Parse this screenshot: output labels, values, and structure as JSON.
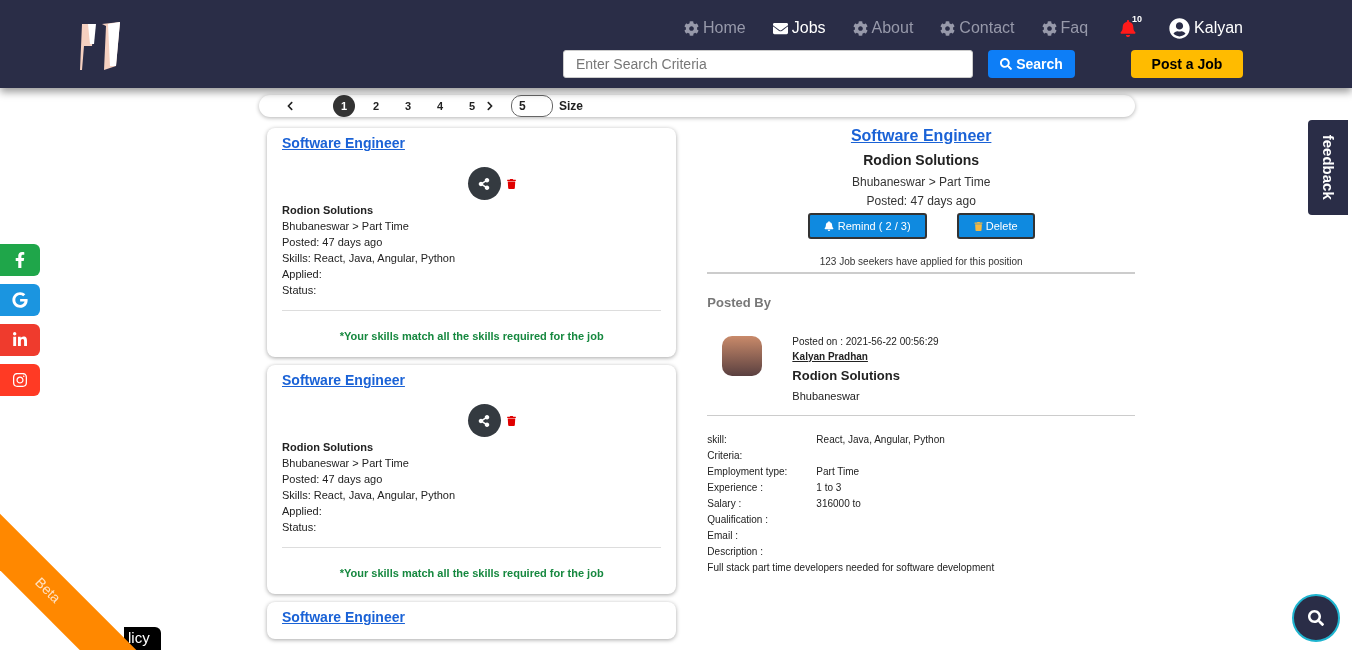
{
  "nav": {
    "items": [
      {
        "label": "Home",
        "kind": "settings",
        "selected": false
      },
      {
        "label": "Jobs",
        "kind": "mail",
        "selected": true
      },
      {
        "label": "About",
        "kind": "settings",
        "selected": false
      },
      {
        "label": "Contact",
        "kind": "settings",
        "selected": false
      },
      {
        "label": "Faq",
        "kind": "settings",
        "selected": false
      }
    ],
    "notification_count": "10",
    "user": "Kalyan"
  },
  "search": {
    "placeholder": "Enter Search Criteria",
    "button": "Search"
  },
  "post_job_button": "Post a Job",
  "pagination": {
    "pages": [
      {
        "label": "1",
        "selected": true
      },
      {
        "label": "2",
        "selected": false
      },
      {
        "label": "3",
        "selected": false
      },
      {
        "label": "4",
        "selected": false
      },
      {
        "label": "5",
        "selected": false
      }
    ],
    "size_value": "5",
    "size_label": "Size"
  },
  "job_cards": [
    {
      "title": "Software Engineer",
      "company": "Rodion Solutions",
      "location": "Bhubaneswar > Part Time",
      "posted": "Posted: 47 days ago",
      "skills": "Skills: React, Java, Angular, Python",
      "applied": "Applied:",
      "status": "Status:",
      "match": "*Your skills match all the skills required for the job"
    },
    {
      "title": "Software Engineer",
      "company": "Rodion Solutions",
      "location": "Bhubaneswar > Part Time",
      "posted": "Posted: 47 days ago",
      "skills": "Skills: React, Java, Angular, Python",
      "applied": "Applied:",
      "status": "Status:",
      "match": "*Your skills match all the skills required for the job"
    },
    {
      "title": "Software Engineer"
    }
  ],
  "detail": {
    "title": "Software Engineer",
    "company": "Rodion Solutions",
    "location": "Bhubaneswar > Part Time",
    "posted": "Posted: 47 days ago",
    "remind_button": "Remind ( 2 / 3)",
    "delete_button": "Delete",
    "applicants": "123 Job seekers have applied for this position",
    "posted_by_heading": "Posted By",
    "poster": {
      "posted_on": "Posted on : 2021-56-22 00:56:29",
      "name": "Kalyan Pradhan",
      "company": "Rodion Solutions",
      "city": "Bhubaneswar"
    },
    "fields": [
      {
        "label": "skill:",
        "value": "React, Java, Angular, Python"
      },
      {
        "label": "Criteria:"
      },
      {
        "label": "Employment type:",
        "value": "Part Time"
      },
      {
        "label": "Experience :",
        "value": "1 to 3"
      },
      {
        "label": "Salary :",
        "value": "316000 to"
      },
      {
        "label": "Qualification :"
      },
      {
        "label": "Email :"
      },
      {
        "label": "Description :"
      }
    ],
    "description": "Full stack part time developers needed for software development"
  },
  "social": [
    {
      "kind": "facebook",
      "color": "#1fa64a"
    },
    {
      "kind": "google",
      "color": "#1b95e0"
    },
    {
      "kind": "linkedin",
      "color": "#ef3b2d"
    },
    {
      "kind": "instagram",
      "color": "#ff3a24"
    }
  ],
  "feedback_tab": "feedback",
  "beta_ribbon": "Beta",
  "policy_badge": "licy"
}
